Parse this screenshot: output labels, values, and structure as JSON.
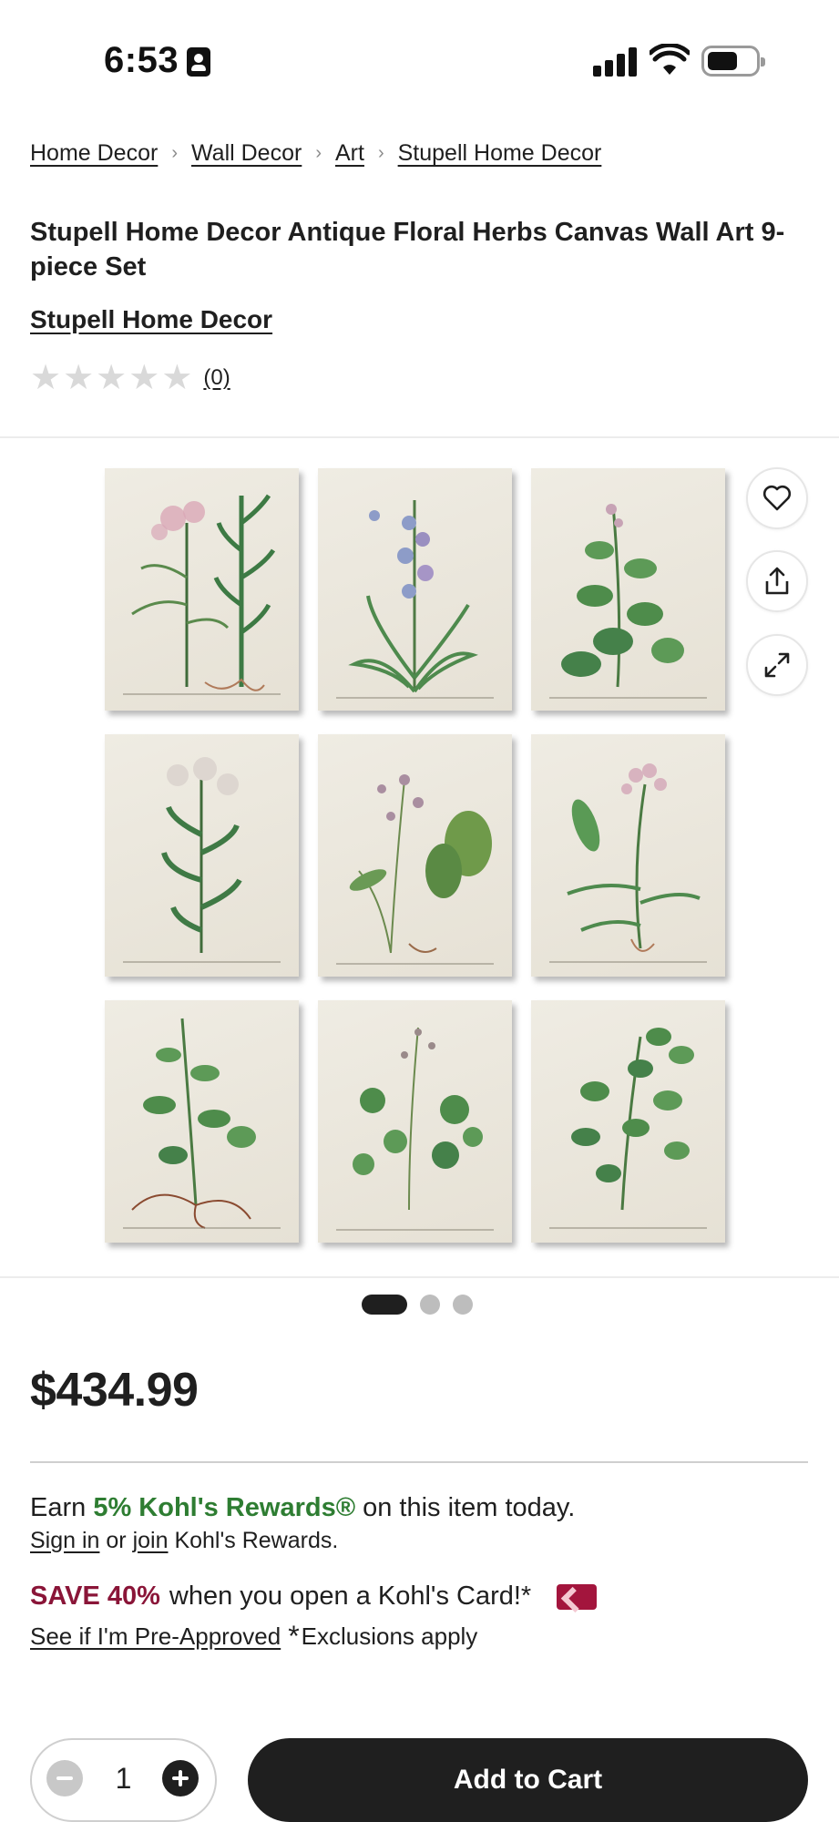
{
  "status_bar": {
    "time": "6:53",
    "icons": [
      "person-badge-icon",
      "cellular-signal-icon",
      "wifi-icon",
      "battery-icon"
    ]
  },
  "breadcrumb": [
    "Home Decor",
    "Wall Decor",
    "Art",
    "Stupell Home Decor"
  ],
  "product": {
    "title": "Stupell Home Decor Antique Floral Herbs Canvas Wall Art 9-piece Set",
    "brand": "Stupell Home Decor",
    "rating_stars": 0,
    "review_count": "(0)",
    "price": "$434.99"
  },
  "image_actions": {
    "icons": [
      "heart-icon",
      "share-icon",
      "expand-icon"
    ]
  },
  "gallery": {
    "total_images": 3,
    "active_index": 0
  },
  "rewards": {
    "prefix": "Earn ",
    "highlight": "5% Kohl's Rewards®",
    "suffix": " on this item today.",
    "signin_link": "Sign in",
    "or_text": " or ",
    "join_link": "join",
    "signin_suffix": " Kohl's Rewards."
  },
  "card_offer": {
    "highlight": "SAVE 40%",
    "text": "when you open a Kohl's Card!*",
    "preapproved_link": "See if I'm Pre-Approved",
    "asterisk": "*",
    "exclusions": "Exclusions apply"
  },
  "cart": {
    "quantity": "1",
    "add_to_cart_label": "Add to Cart"
  },
  "colors": {
    "rewards_green": "#2e7d32",
    "save_red": "#8a1538",
    "button_dark": "#1f1f1f"
  }
}
